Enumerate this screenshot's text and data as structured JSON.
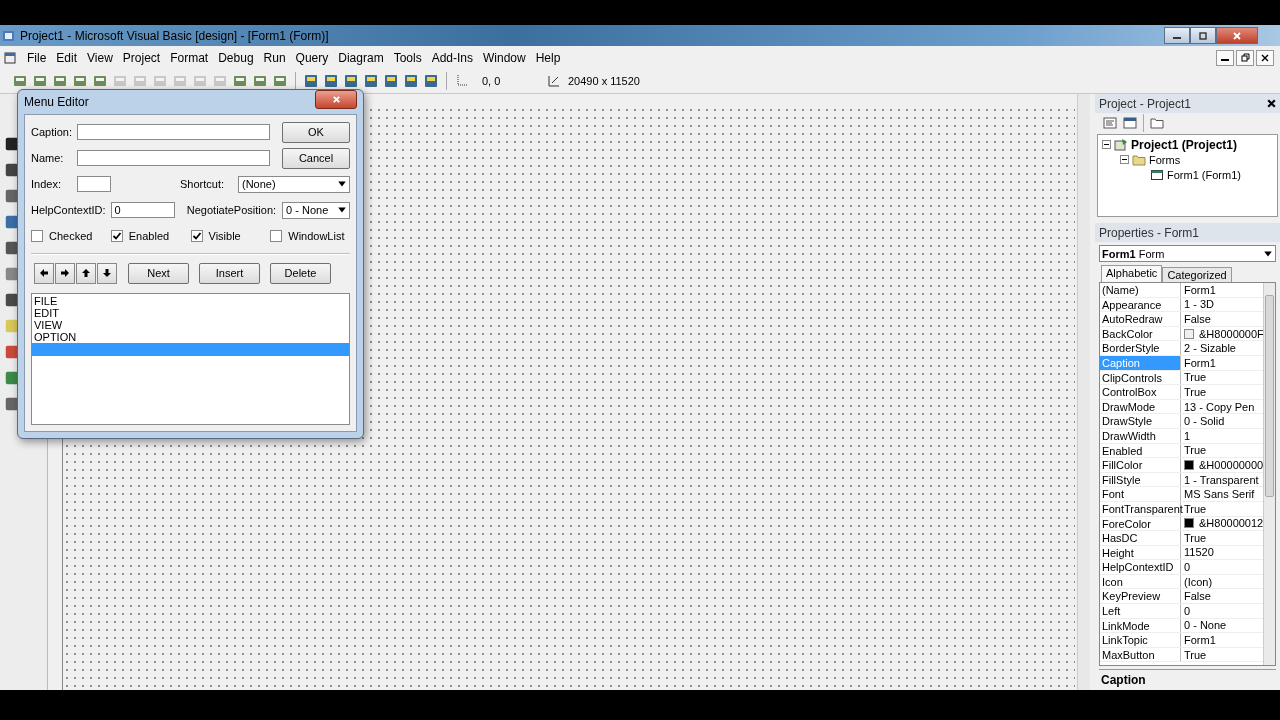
{
  "window": {
    "title": "Project1 - Microsoft Visual Basic [design] - [Form1 (Form)]"
  },
  "menu_bar": [
    "File",
    "Edit",
    "View",
    "Project",
    "Format",
    "Debug",
    "Run",
    "Query",
    "Diagram",
    "Tools",
    "Add-Ins",
    "Window",
    "Help"
  ],
  "toolbar": {
    "position": "0, 0",
    "size": "20490 x 11520"
  },
  "menu_editor": {
    "title": "Menu Editor",
    "caption_label": "Caption:",
    "name_label": "Name:",
    "index_label": "Index:",
    "shortcut": {
      "label": "Shortcut:",
      "value": "(None)"
    },
    "help_context": {
      "label": "HelpContextID:",
      "value": "0"
    },
    "negotiate": {
      "label": "NegotiatePosition:",
      "value": "0 - None"
    },
    "checkboxes": [
      {
        "label": "Checked",
        "checked": false
      },
      {
        "label": "Enabled",
        "checked": true
      },
      {
        "label": "Visible",
        "checked": true
      },
      {
        "label": "WindowList",
        "checked": false
      }
    ],
    "ok": "OK",
    "cancel": "Cancel",
    "buttons": [
      "Next",
      "Insert",
      "Delete"
    ],
    "items": [
      {
        "text": "FILE",
        "selected": false
      },
      {
        "text": "EDIT",
        "selected": false
      },
      {
        "text": "VIEW",
        "selected": false
      },
      {
        "text": "OPTION",
        "selected": false
      },
      {
        "selected": true
      }
    ]
  },
  "project_explorer": {
    "title": "Project - Project1",
    "tree": [
      {
        "label": "Project1 (Project1)",
        "expanded": true,
        "children": [
          {
            "label": "Forms",
            "expanded": true,
            "children": [
              {
                "label": "Form1 (Form1)"
              }
            ]
          }
        ]
      }
    ]
  },
  "properties": {
    "title": "Properties - Form1",
    "object_name": "Form1",
    "object_type": "Form",
    "tabs": [
      {
        "label": "Alphabetic",
        "selected": true
      },
      {
        "label": "Categorized",
        "selected": false
      }
    ],
    "rows": [
      {
        "name": "(Name)",
        "value": "Form1",
        "selected": false
      },
      {
        "name": "Appearance",
        "value": "1 - 3D",
        "selected": false
      },
      {
        "name": "AutoRedraw",
        "value": "False",
        "selected": false
      },
      {
        "name": "BackColor",
        "value": "&H8000000F",
        "selected": false,
        "color": "#f0f0f0"
      },
      {
        "name": "BorderStyle",
        "value": "2 - Sizable",
        "selected": false
      },
      {
        "name": "Caption",
        "value": "Form1",
        "selected": true
      },
      {
        "name": "ClipControls",
        "value": "True",
        "selected": false
      },
      {
        "name": "ControlBox",
        "value": "True",
        "selected": false
      },
      {
        "name": "DrawMode",
        "value": "13 - Copy Pen",
        "selected": false
      },
      {
        "name": "DrawStyle",
        "value": "0 - Solid",
        "selected": false
      },
      {
        "name": "DrawWidth",
        "value": "1",
        "selected": false
      },
      {
        "name": "Enabled",
        "value": "True",
        "selected": false
      },
      {
        "name": "FillColor",
        "value": "&H00000000",
        "selected": false,
        "color": "#000000"
      },
      {
        "name": "FillStyle",
        "value": "1 - Transparent",
        "selected": false
      },
      {
        "name": "Font",
        "value": "MS Sans Serif",
        "selected": false
      },
      {
        "name": "FontTransparent",
        "value": "True",
        "selected": false
      },
      {
        "name": "ForeColor",
        "value": "&H80000012",
        "selected": false,
        "color": "#000000"
      },
      {
        "name": "HasDC",
        "value": "True",
        "selected": false
      },
      {
        "name": "Height",
        "value": "11520",
        "selected": false
      },
      {
        "name": "HelpContextID",
        "value": "0",
        "selected": false
      },
      {
        "name": "Icon",
        "value": "(Icon)",
        "selected": false
      },
      {
        "name": "KeyPreview",
        "value": "False",
        "selected": false
      },
      {
        "name": "Left",
        "value": "0",
        "selected": false
      },
      {
        "name": "LinkMode",
        "value": "0 - None",
        "selected": false
      },
      {
        "name": "LinkTopic",
        "value": "Form1",
        "selected": false
      },
      {
        "name": "MaxButton",
        "value": "True",
        "selected": false
      }
    ],
    "description_title": "Caption"
  }
}
